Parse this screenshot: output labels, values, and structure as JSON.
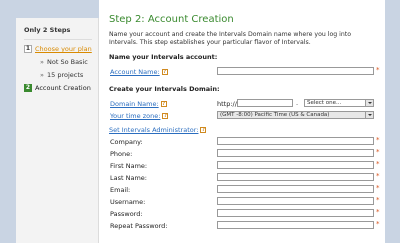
{
  "sidebar": {
    "heading": "Only 2 Steps",
    "steps": [
      {
        "num": "1",
        "label": "Choose your plan"
      },
      {
        "num": "2",
        "label": "Account Creation"
      }
    ],
    "sub_items": [
      "Not So Basic",
      "15 projects"
    ]
  },
  "main": {
    "title": "Step 2: Account Creation",
    "intro": "Name your account and create the Intervals Domain name where you log into Intervals. This step establishes your particular flavor of Intervals.",
    "section_account": "Name your Intervals account:",
    "account_name_label": "Account Name:",
    "section_domain": "Create your Intervals Domain:",
    "domain_name_label": "Domain Name:",
    "domain_prefix": "http://",
    "domain_dot": ".",
    "domain_select": "Select one...",
    "time_zone_label": "Your time zone:",
    "time_zone_value": "(GMT -8:00) Pacific Time (US & Canada)",
    "admin_link": "Set Intervals Administrator:",
    "fields": [
      {
        "label": "Company:"
      },
      {
        "label": "Phone:"
      },
      {
        "label": "First Name:"
      },
      {
        "label": "Last Name:"
      },
      {
        "label": "Email:"
      },
      {
        "label": "Username:"
      },
      {
        "label": "Password:"
      },
      {
        "label": "Repeat Password:"
      }
    ],
    "required_mark": "*",
    "info_mark": "?"
  },
  "colors": {
    "accent_green": "#3a8a2f",
    "link_blue": "#2a6dbf",
    "required_orange": "#d9541e"
  }
}
